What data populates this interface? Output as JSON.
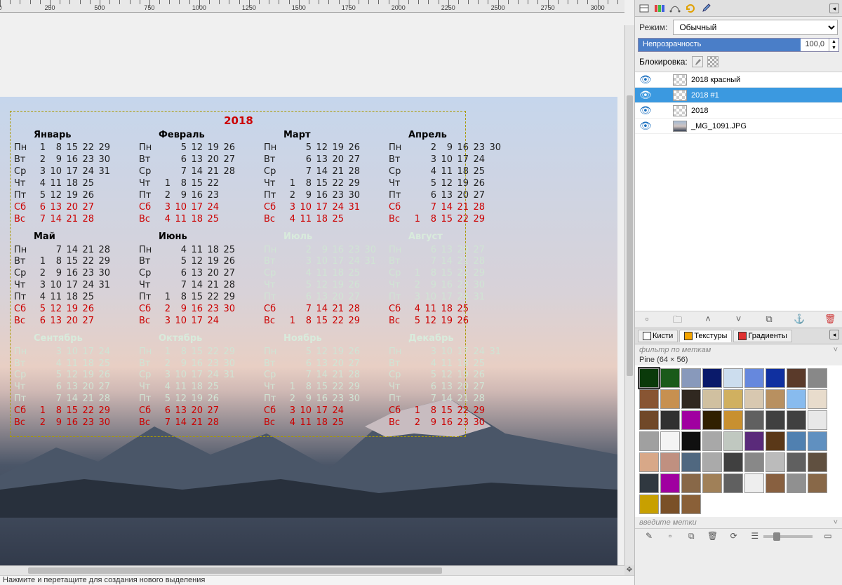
{
  "status_bar": "Нажмите и перетащите для создания нового выделения",
  "ruler_marks": [
    0,
    250,
    500,
    750,
    1000,
    1250,
    1500,
    1750,
    2000,
    2250,
    2500,
    2750,
    3000
  ],
  "calendar": {
    "year": "2018",
    "weekdays": [
      "Пн",
      "Вт",
      "Ср",
      "Чт",
      "Пт",
      "Сб",
      "Вс"
    ],
    "months": [
      {
        "name": "Январь",
        "start": 0,
        "days": 31,
        "faded": false
      },
      {
        "name": "Февраль",
        "start": 3,
        "days": 28,
        "faded": false
      },
      {
        "name": "Март",
        "start": 3,
        "days": 31,
        "faded": false
      },
      {
        "name": "Апрель",
        "start": 6,
        "days": 30,
        "faded": false
      },
      {
        "name": "Май",
        "start": 1,
        "days": 31,
        "faded": false
      },
      {
        "name": "Июнь",
        "start": 4,
        "days": 30,
        "faded": false
      },
      {
        "name": "Июль",
        "start": 6,
        "days": 31,
        "faded": true
      },
      {
        "name": "Август",
        "start": 2,
        "days": 31,
        "faded": true
      },
      {
        "name": "Сентябрь",
        "start": 5,
        "days": 30,
        "faded": true
      },
      {
        "name": "Октябрь",
        "start": 0,
        "days": 31,
        "faded": true
      },
      {
        "name": "Ноябрь",
        "start": 3,
        "days": 30,
        "faded": true
      },
      {
        "name": "Декабрь",
        "start": 5,
        "days": 31,
        "faded": true
      }
    ]
  },
  "layers_panel": {
    "mode_label": "Режим:",
    "mode_value": "Обычный",
    "opacity_label": "Непрозрачность",
    "opacity_value": "100,0",
    "lock_label": "Блокировка:",
    "layers": [
      {
        "name": "2018 красный",
        "thumb": "checker",
        "selected": false
      },
      {
        "name": "2018 #1",
        "thumb": "checker",
        "selected": true
      },
      {
        "name": "2018",
        "thumb": "checker",
        "selected": false
      },
      {
        "name": "_MG_1091.JPG",
        "thumb": "img",
        "selected": false
      }
    ]
  },
  "resource_panel": {
    "tabs": [
      {
        "label": "Кисти",
        "color": "#fff",
        "active": false
      },
      {
        "label": "Текстуры",
        "color": "#f4a400",
        "active": true
      },
      {
        "label": "Градиенты",
        "color": "#e03030",
        "active": false
      }
    ],
    "filter_placeholder": "фильтр по меткам",
    "info": "Pine (64 × 56)",
    "texture_colors": [
      "#0a3a0a",
      "#1a5a1a",
      "#8899bb",
      "#0a1a6a",
      "#ccddee",
      "#6688dd",
      "#1030a0",
      "#5a3a2a",
      "#888888",
      "#885533",
      "#c79050",
      "#302820",
      "#d0c0a0",
      "#d0b060",
      "#d8c8b0",
      "#b89060",
      "#88bbee",
      "#e8dccc",
      "#704828",
      "#303030",
      "#a000a0",
      "#302000",
      "#c89030",
      "#606060",
      "#404040",
      "#404040",
      "#e8e8e8",
      "#a0a0a0",
      "#f4f4f4",
      "#101010",
      "#a8a8a8",
      "#c0c8c0",
      "#5a2a7a",
      "#5a3818",
      "#5080b0",
      "#6090c0",
      "#d8a888",
      "#c09080",
      "#506880",
      "#aaaaaa",
      "#404040",
      "#888888",
      "#bbbbbb",
      "#606060",
      "#605040",
      "#303840",
      "#a000a0",
      "#886848",
      "#a08058",
      "#606060",
      "#eeeeee",
      "#886040",
      "#909090",
      "#886848",
      "#c8a000",
      "#7a5028",
      "#8a6038"
    ],
    "enter_tags": "введите метки"
  }
}
